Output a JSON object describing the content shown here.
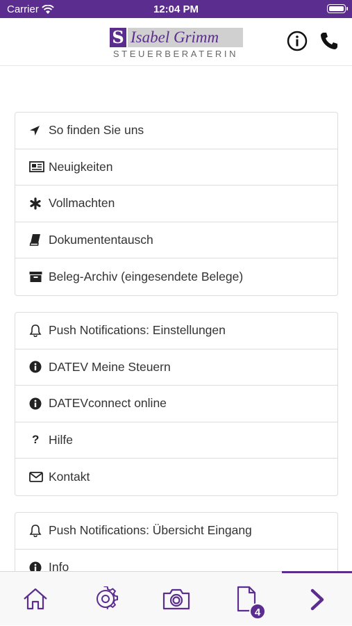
{
  "status_bar": {
    "carrier": "Carrier",
    "time": "12:04 PM"
  },
  "header": {
    "logo_mark": "S",
    "logo_name": "Isabel Grimm",
    "logo_subtitle": "STEUERBERATERIN",
    "info_icon": "info-circle-icon",
    "phone_icon": "phone-icon"
  },
  "menu_groups": [
    {
      "items": [
        {
          "label": "So finden Sie uns",
          "icon": "location-arrow-icon"
        },
        {
          "label": "Neuigkeiten",
          "icon": "newspaper-icon"
        },
        {
          "label": "Vollmachten",
          "icon": "asterisk-icon"
        },
        {
          "label": "Dokumententausch",
          "icon": "book-icon"
        },
        {
          "label": "Beleg-Archiv (eingesendete Belege)",
          "icon": "archive-icon"
        }
      ]
    },
    {
      "items": [
        {
          "label": "Push Notifications: Einstellungen",
          "icon": "bell-icon"
        },
        {
          "label": "DATEV Meine Steuern",
          "icon": "info-icon"
        },
        {
          "label": "DATEVconnect online",
          "icon": "info-icon"
        },
        {
          "label": "Hilfe",
          "icon": "question-icon"
        },
        {
          "label": "Kontakt",
          "icon": "envelope-icon"
        }
      ]
    },
    {
      "items": [
        {
          "label": "Push Notifications: Übersicht Eingang",
          "icon": "bell-icon"
        },
        {
          "label": "Info",
          "icon": "info-icon"
        }
      ]
    }
  ],
  "tab_bar": {
    "tabs": [
      {
        "icon": "home-icon"
      },
      {
        "icon": "gear-icon"
      },
      {
        "icon": "camera-icon"
      },
      {
        "icon": "document-icon",
        "badge": "4"
      },
      {
        "icon": "chevron-right-icon"
      }
    ]
  },
  "colors": {
    "brand": "#5b2d8e",
    "text": "#333333",
    "border": "#dddddd"
  }
}
